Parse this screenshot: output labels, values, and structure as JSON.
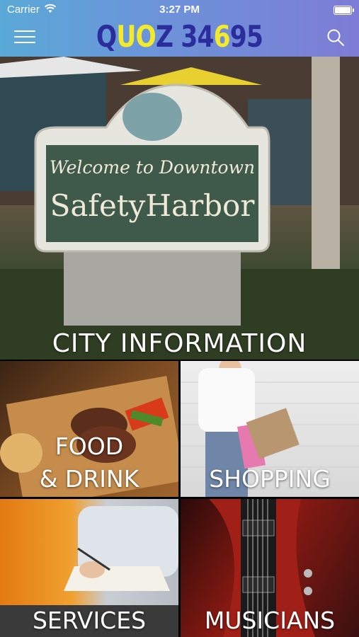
{
  "status_bar": {
    "carrier": "Carrier",
    "time": "3:27 PM"
  },
  "header": {
    "logo_parts": [
      {
        "text": "Q",
        "color": "#2b2d9c"
      },
      {
        "text": "U",
        "color": "#f2ea2a"
      },
      {
        "text": "O",
        "color": "#f2ea2a"
      },
      {
        "text": "Z",
        "color": "#2b2d9c"
      },
      {
        "text": " ",
        "color": "#2b2d9c"
      },
      {
        "text": "3",
        "color": "#2b2d9c"
      },
      {
        "text": "4",
        "color": "#2b2d9c"
      },
      {
        "text": "6",
        "color": "#f2ea2a"
      },
      {
        "text": "9",
        "color": "#2b2d9c"
      },
      {
        "text": "5",
        "color": "#2b2d9c"
      }
    ],
    "gradient_colors": [
      "#5aa9d8",
      "#7e7cd6"
    ]
  },
  "hero": {
    "label": "CITY INFORMATION",
    "photo_sign_text": [
      "Welcome to Downtown",
      "SafetyHarbor"
    ]
  },
  "tiles": [
    {
      "id": "food",
      "label_line1": "FOOD",
      "label_line2": "& DRINK"
    },
    {
      "id": "shopping",
      "label": "SHOPPING"
    },
    {
      "id": "services",
      "label": "SERVICES"
    },
    {
      "id": "musicians",
      "label": "MUSICIANS"
    }
  ],
  "icons": [
    "wifi-icon",
    "battery-icon",
    "hamburger-menu-icon",
    "search-icon"
  ]
}
